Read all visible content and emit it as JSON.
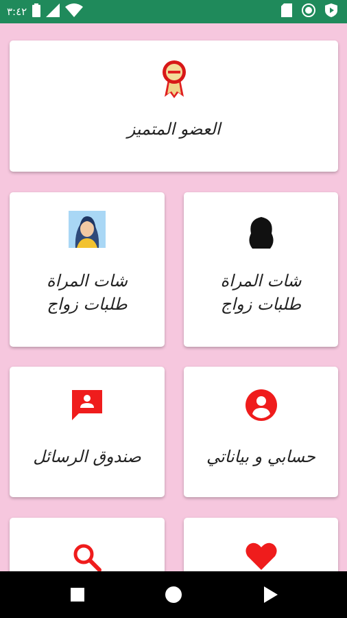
{
  "status_bar": {
    "time": "٣:٤٢",
    "icons": [
      "battery-icon",
      "signal-icon",
      "wifi-icon",
      "sd-card-icon",
      "circle-status-icon",
      "play-protect-icon"
    ]
  },
  "cards": {
    "featured_member": {
      "label": "العضو المتميز",
      "icon": "award-ribbon-icon"
    },
    "women_chat_marriage_left": {
      "label": "شات المراة طلبات زواج",
      "icon": "woman-avatar-icon"
    },
    "women_chat_marriage_right": {
      "label": "شات المراة طلبات زواج",
      "icon": "woman-silhouette-icon"
    },
    "messages_box": {
      "label": "صندوق الرسائل",
      "icon": "contact-message-icon"
    },
    "my_account": {
      "label": "حسابي و بياناتي",
      "icon": "account-circle-icon"
    },
    "search": {
      "label": "",
      "icon": "search-icon"
    },
    "favorites": {
      "label": "",
      "icon": "heart-icon"
    }
  },
  "colors": {
    "background": "#f6c7de",
    "status_bar": "#1f8a5b",
    "accent_red": "#ef1c1c",
    "card": "#ffffff"
  },
  "nav_bar": {
    "buttons": [
      "recents-square-icon",
      "home-circle-icon",
      "back-triangle-icon"
    ]
  }
}
